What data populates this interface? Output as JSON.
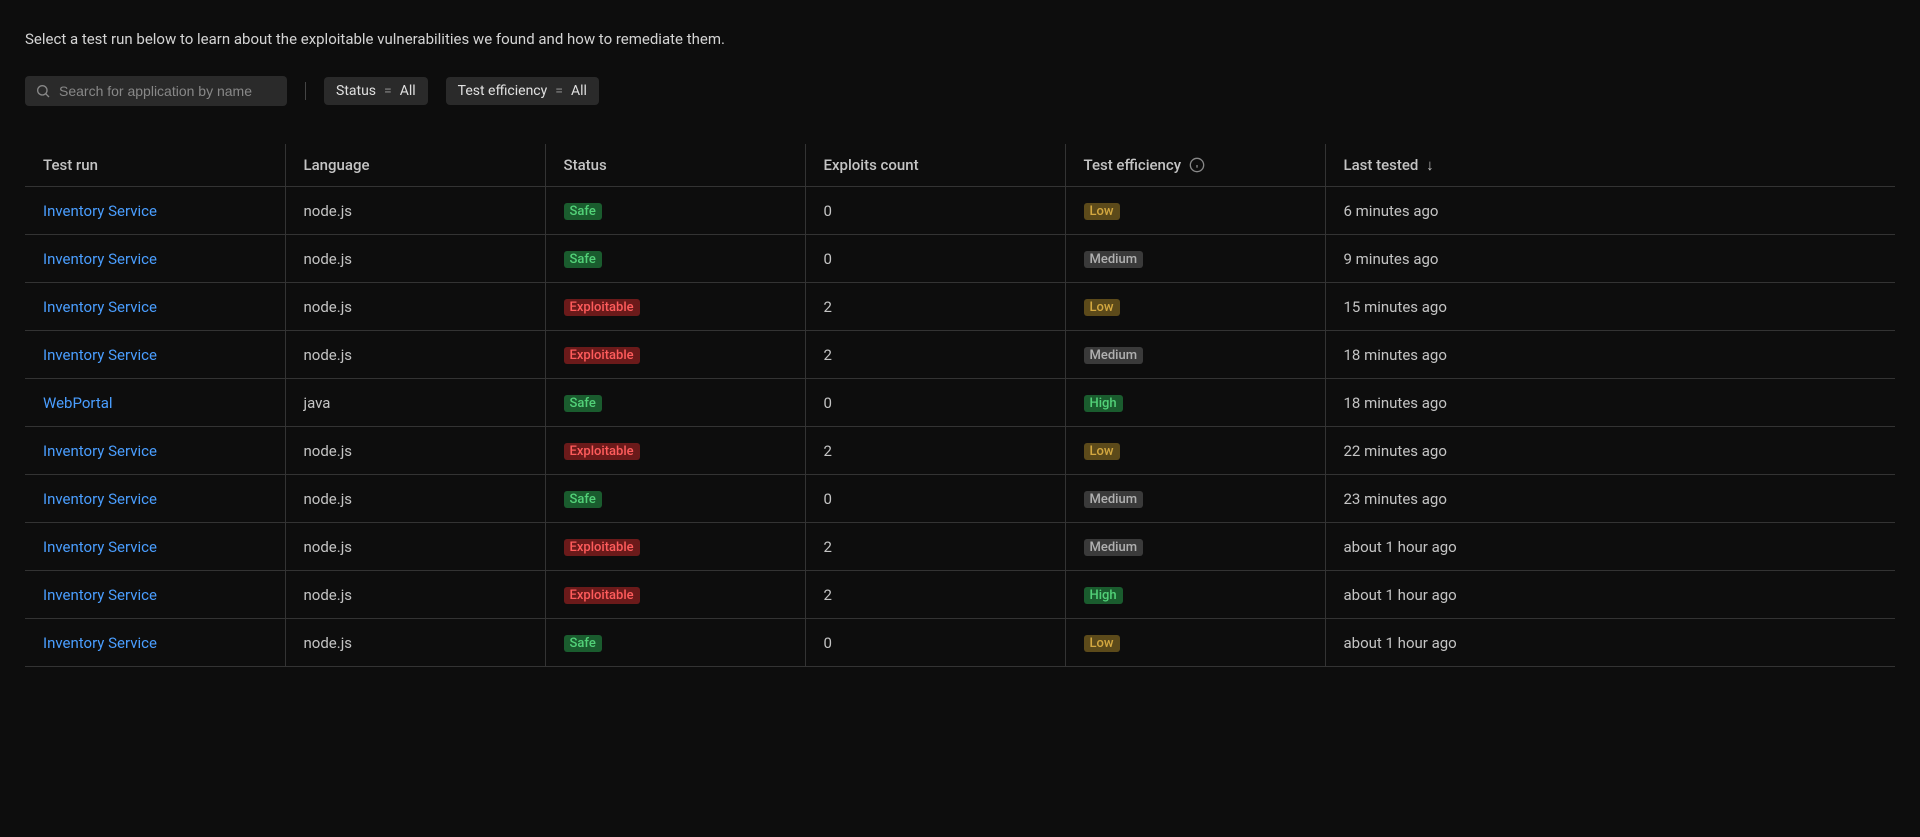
{
  "description": "Select a test run below to learn about the exploitable vulnerabilities we found and how to remediate them.",
  "search": {
    "placeholder": "Search for application by name"
  },
  "filters": [
    {
      "label": "Status",
      "equals": "=",
      "value": "All"
    },
    {
      "label": "Test efficiency",
      "equals": "=",
      "value": "All"
    }
  ],
  "columns": {
    "test_run": "Test run",
    "language": "Language",
    "status": "Status",
    "exploits_count": "Exploits count",
    "test_efficiency": "Test efficiency",
    "last_tested": "Last tested",
    "sort_arrow": "↓"
  },
  "status_labels": {
    "safe": "Safe",
    "exploitable": "Exploitable"
  },
  "efficiency_labels": {
    "low": "Low",
    "medium": "Medium",
    "high": "High"
  },
  "rows": [
    {
      "name": "Inventory Service",
      "language": "node.js",
      "status": "safe",
      "exploits": "0",
      "efficiency": "low",
      "last_tested": "6 minutes ago"
    },
    {
      "name": "Inventory Service",
      "language": "node.js",
      "status": "safe",
      "exploits": "0",
      "efficiency": "medium",
      "last_tested": "9 minutes ago"
    },
    {
      "name": "Inventory Service",
      "language": "node.js",
      "status": "exploitable",
      "exploits": "2",
      "efficiency": "low",
      "last_tested": "15 minutes ago"
    },
    {
      "name": "Inventory Service",
      "language": "node.js",
      "status": "exploitable",
      "exploits": "2",
      "efficiency": "medium",
      "last_tested": "18 minutes ago"
    },
    {
      "name": "WebPortal",
      "language": "java",
      "status": "safe",
      "exploits": "0",
      "efficiency": "high",
      "last_tested": "18 minutes ago"
    },
    {
      "name": "Inventory Service",
      "language": "node.js",
      "status": "exploitable",
      "exploits": "2",
      "efficiency": "low",
      "last_tested": "22 minutes ago"
    },
    {
      "name": "Inventory Service",
      "language": "node.js",
      "status": "safe",
      "exploits": "0",
      "efficiency": "medium",
      "last_tested": "23 minutes ago"
    },
    {
      "name": "Inventory Service",
      "language": "node.js",
      "status": "exploitable",
      "exploits": "2",
      "efficiency": "medium",
      "last_tested": "about 1 hour ago"
    },
    {
      "name": "Inventory Service",
      "language": "node.js",
      "status": "exploitable",
      "exploits": "2",
      "efficiency": "high",
      "last_tested": "about 1 hour ago"
    },
    {
      "name": "Inventory Service",
      "language": "node.js",
      "status": "safe",
      "exploits": "0",
      "efficiency": "low",
      "last_tested": "about 1 hour ago"
    }
  ]
}
